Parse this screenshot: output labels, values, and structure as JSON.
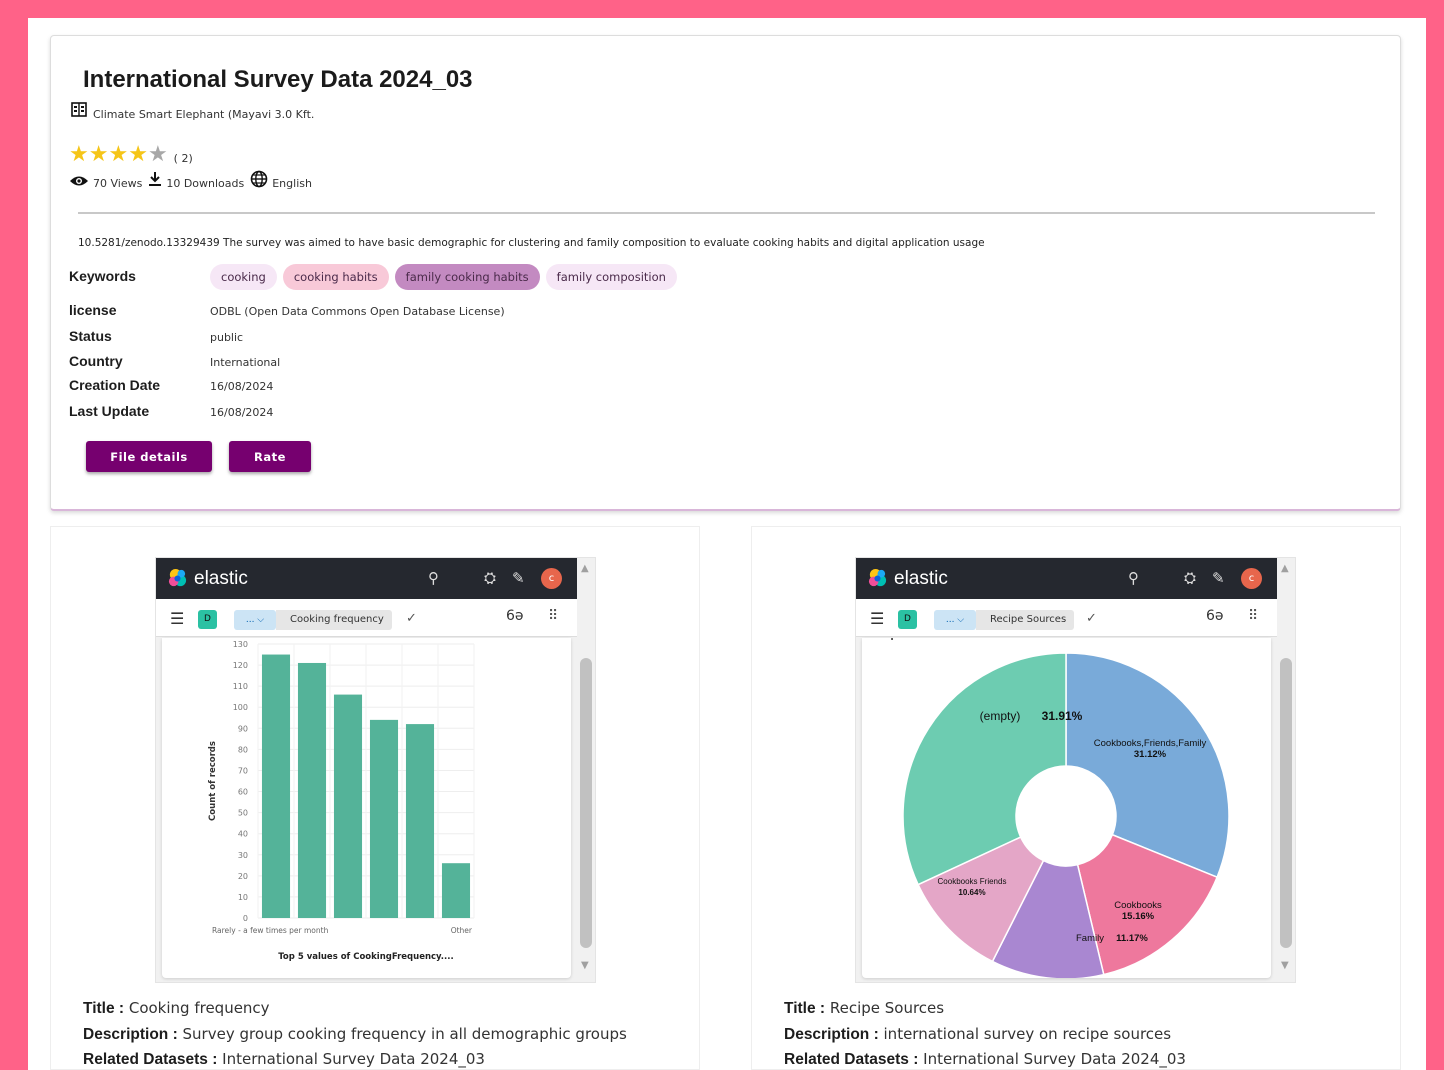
{
  "header": {
    "title": "International Survey Data 2024_03",
    "publisher": "Climate Smart Elephant (Mayavi 3.0 Kft.",
    "rating": {
      "value": 4,
      "max": 5,
      "count_text": "( 2)"
    },
    "stats": {
      "views": "70 Views",
      "downloads": "10 Downloads",
      "language": "English"
    }
  },
  "description": "10.5281/zenodo.13329439 The survey was aimed to have basic demographic for clustering and family composition to evaluate cooking habits and digital application usage",
  "metadata": {
    "keywords_label": "Keywords",
    "keywords": [
      {
        "text": "cooking",
        "color": "#f6e7f6"
      },
      {
        "text": "cooking habits",
        "color": "#f8c9d8"
      },
      {
        "text": "family cooking habits",
        "color": "#c38ac1"
      },
      {
        "text": "family composition",
        "color": "#f6e7f6"
      }
    ],
    "license_label": "license",
    "license_value": "ODBL (Open Data Commons Open Database License)",
    "status_label": "Status",
    "status_value": "public",
    "country_label": "Country",
    "country_value": "International",
    "creation_label": "Creation Date",
    "creation_value": "16/08/2024",
    "update_label": "Last Update",
    "update_value": "16/08/2024"
  },
  "actions": {
    "file_details": "File details",
    "rate": "Rate"
  },
  "colors": {
    "accent": "#76006f",
    "frame": "#ff6288",
    "bar": "#54b399"
  },
  "panels": [
    {
      "app_name": "elastic",
      "avatar_letter": "c",
      "space_badge": "D",
      "crumb_collapsed": "... ⌵",
      "crumb_current": "Cooking frequency",
      "info": {
        "title_label": "Title :",
        "title_value": "Cooking frequency",
        "description_label": "Description :",
        "description_value": "Survey group cooking frequency in all demographic groups",
        "related_label": "Related Datasets :",
        "related_value": "International Survey Data 2024_03"
      }
    },
    {
      "app_name": "elastic",
      "avatar_letter": "c",
      "space_badge": "D",
      "crumb_collapsed": "... ⌵",
      "crumb_current": "Recipe Sources",
      "info": {
        "title_label": "Title :",
        "title_value": "Recipe Sources",
        "description_label": "Description :",
        "description_value": "international survey on recipe sources",
        "related_label": "Related Datasets :",
        "related_value": "International Survey Data 2024_03"
      }
    }
  ],
  "chart_data": [
    {
      "type": "bar",
      "title": "",
      "xlabel": "Top 5 values of CookingFrequency....",
      "ylabel": "Count of records",
      "categories": [
        "Rarely - a few times per month",
        "",
        "",
        "",
        "",
        "Other"
      ],
      "values": [
        125,
        121,
        106,
        94,
        92,
        26
      ],
      "ylim": [
        0,
        130
      ],
      "yticks": [
        0,
        10,
        20,
        30,
        40,
        50,
        60,
        70,
        80,
        90,
        100,
        110,
        120,
        130
      ],
      "grid": true,
      "color": "#54b399"
    },
    {
      "type": "pie",
      "title": "Recipe Sources",
      "donut": true,
      "slices": [
        {
          "label": "Cookbooks,Friends,Family",
          "percent": "31.12%",
          "value": 31.12,
          "color": "#79aad9"
        },
        {
          "label": "Cookbooks",
          "percent": "15.16%",
          "value": 15.16,
          "color": "#ee789d"
        },
        {
          "label": "Family",
          "percent": "11.17%",
          "value": 11.17,
          "color": "#a987d1"
        },
        {
          "label": "Cookbooks Friends",
          "percent": "10.64%",
          "value": 10.64,
          "color": "#e4a6c7"
        },
        {
          "label": "(empty)",
          "percent": "31.91%",
          "value": 31.91,
          "color": "#6dccb1"
        }
      ]
    }
  ]
}
